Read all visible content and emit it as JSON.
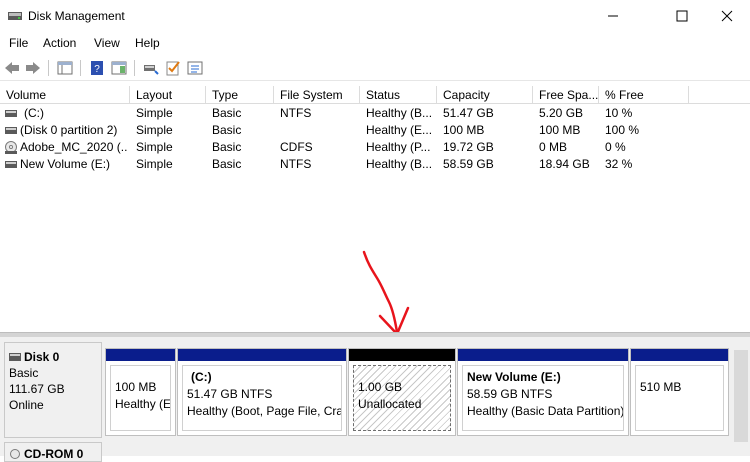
{
  "window": {
    "title": "Disk Management"
  },
  "menu": [
    "File",
    "Action",
    "View",
    "Help"
  ],
  "list": {
    "columns": [
      "Volume",
      "Layout",
      "Type",
      "File System",
      "Status",
      "Capacity",
      "Free Spa...",
      "% Free"
    ],
    "rows": [
      [
        "(C:)",
        "Simple",
        "Basic",
        "NTFS",
        "Healthy (B...",
        "51.47 GB",
        "5.20 GB",
        "10 %"
      ],
      [
        "(Disk 0 partition 2)",
        "Simple",
        "Basic",
        "",
        "Healthy (E...",
        "100 MB",
        "100 MB",
        "100 %"
      ],
      [
        "Adobe_MC_2020 (...",
        "Simple",
        "Basic",
        "CDFS",
        "Healthy (P...",
        "19.72 GB",
        "0 MB",
        "0 %"
      ],
      [
        "New Volume (E:)",
        "Simple",
        "Basic",
        "NTFS",
        "Healthy (B...",
        "58.59 GB",
        "18.94 GB",
        "32 %"
      ]
    ]
  },
  "disk0": {
    "name": "Disk 0",
    "type": "Basic",
    "size": "111.67 GB",
    "status": "Online",
    "partitions": [
      {
        "line1": "",
        "line2": "100 MB",
        "line3": "Healthy (EI"
      },
      {
        "line1": "(C:)",
        "line2": "51.47 GB NTFS",
        "line3": "Healthy (Boot, Page File, Cras"
      },
      {
        "line1": "",
        "line2": "1.00 GB",
        "line3": "Unallocated"
      },
      {
        "line1": "New Volume  (E:)",
        "line2": "58.59 GB NTFS",
        "line3": "Healthy (Basic Data Partition)"
      },
      {
        "line1": "",
        "line2": "510 MB",
        "line3": ""
      }
    ]
  },
  "cdrom": {
    "name": "CD-ROM 0"
  },
  "colors": {
    "partition_bar": "#0a1d8c",
    "unallocated_bar": "#000000",
    "annotation_arrow": "#e8141c"
  }
}
